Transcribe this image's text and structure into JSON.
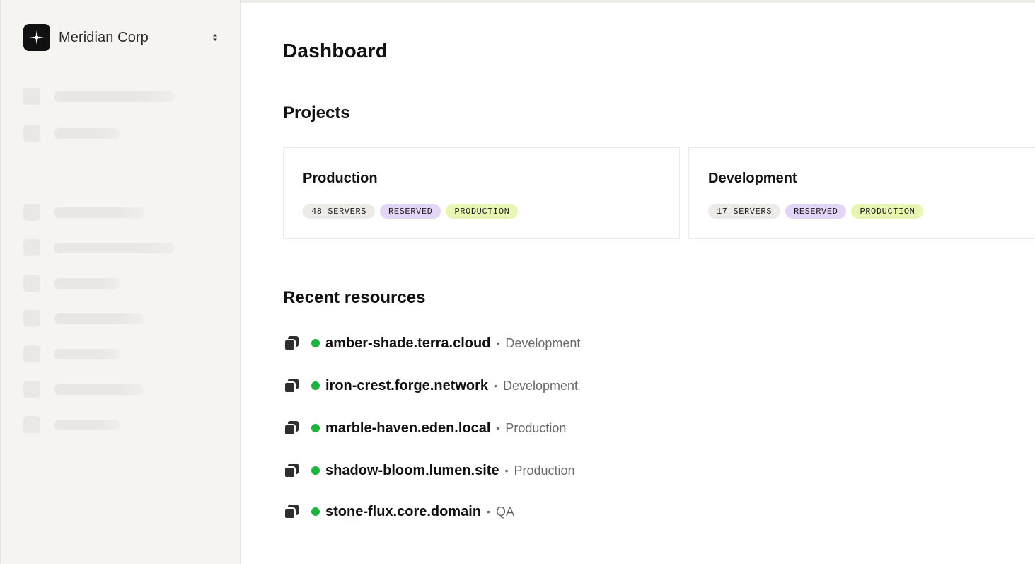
{
  "sidebar": {
    "org_name": "Meridian Corp",
    "org_logo_icon": "sparkle-cross-icon",
    "switcher_icon": "chevron-up-down-icon"
  },
  "main": {
    "title": "Dashboard",
    "projects_heading": "Projects",
    "projects": [
      {
        "name": "Production",
        "tags": [
          "48 SERVERS",
          "RESERVED",
          "PRODUCTION"
        ]
      },
      {
        "name": "Development",
        "tags": [
          "17 SERVERS",
          "RESERVED",
          "PRODUCTION"
        ]
      }
    ],
    "recent_heading": "Recent resources",
    "resources": [
      {
        "name": "amber-shade.terra.cloud",
        "separator": "•",
        "environment": "Development",
        "status": "online"
      },
      {
        "name": "iron-crest.forge.network",
        "separator": "•",
        "environment": "Development",
        "status": "online"
      },
      {
        "name": "marble-haven.eden.local",
        "separator": "•",
        "environment": "Production",
        "status": "online"
      },
      {
        "name": "shadow-bloom.lumen.site",
        "separator": "•",
        "environment": "Production",
        "status": "online"
      },
      {
        "name": "stone-flux.core.domain",
        "separator": "•",
        "environment": "QA",
        "status": "online"
      }
    ]
  },
  "colors": {
    "sidebar_bg": "#f5f4f1",
    "status_online": "#1bb33a",
    "tag_neutral": "#ecebe8",
    "tag_reserved": "#e3d5f6",
    "tag_production": "#e8f6b4"
  }
}
